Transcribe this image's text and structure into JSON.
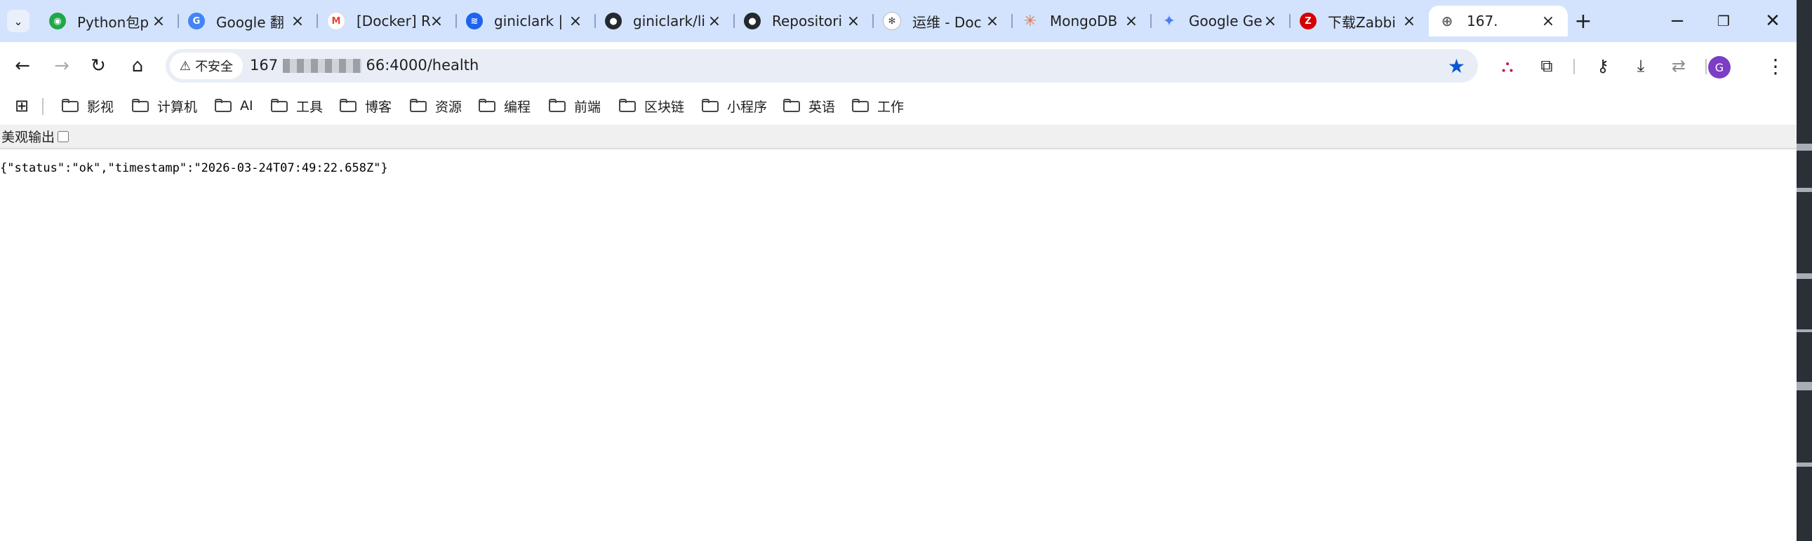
{
  "tabs": [
    {
      "title": "Python包p",
      "favicon": "pypi-icon",
      "color": "#20a74a",
      "active": false
    },
    {
      "title": "Google 翻",
      "favicon": "google-translate-icon",
      "color": "#4285f4",
      "active": false
    },
    {
      "title": "[Docker] R",
      "favicon": "gmail-icon",
      "color": "#ea4335",
      "active": false
    },
    {
      "title": "giniclark | ",
      "favicon": "docker-icon",
      "color": "#1d63ed",
      "active": false
    },
    {
      "title": "giniclark/li",
      "favicon": "github-icon",
      "color": "#24292f",
      "active": false
    },
    {
      "title": "Repositori",
      "favicon": "github-icon",
      "color": "#24292f",
      "active": false
    },
    {
      "title": "运维 - Doc",
      "favicon": "openai-icon",
      "color": "#444746",
      "active": false
    },
    {
      "title": "MongoDB",
      "favicon": "claude-icon",
      "color": "#d97757",
      "active": false
    },
    {
      "title": "Google Ge",
      "favicon": "gemini-icon",
      "color": "#4f7df3",
      "active": false
    },
    {
      "title": "下载Zabbi",
      "favicon": "zabbix-icon",
      "color": "#d40000",
      "active": false
    },
    {
      "title": "167.",
      "favicon": "globe-icon",
      "color": "#5f6368",
      "active": true
    }
  ],
  "toolbar": {
    "security_label": "不安全",
    "url_prefix": "167",
    "url_suffix": "66:4000/health"
  },
  "profile": {
    "initial": "G",
    "color": "#7b3ec4"
  },
  "bookmarks": [
    "影视",
    "计算机",
    "AI",
    "工具",
    "博客",
    "资源",
    "编程",
    "前端",
    "区块链",
    "小程序",
    "英语",
    "工作"
  ],
  "prettyprint": {
    "label": "美观输出",
    "checked": false
  },
  "content": {
    "json_text": "{\"status\":\"ok\",\"timestamp\":\"2026-03-24T07:49:22.658Z\"}"
  },
  "colors": {
    "tabstrip": "#d3e3fd",
    "accent": "#0b57d0"
  }
}
